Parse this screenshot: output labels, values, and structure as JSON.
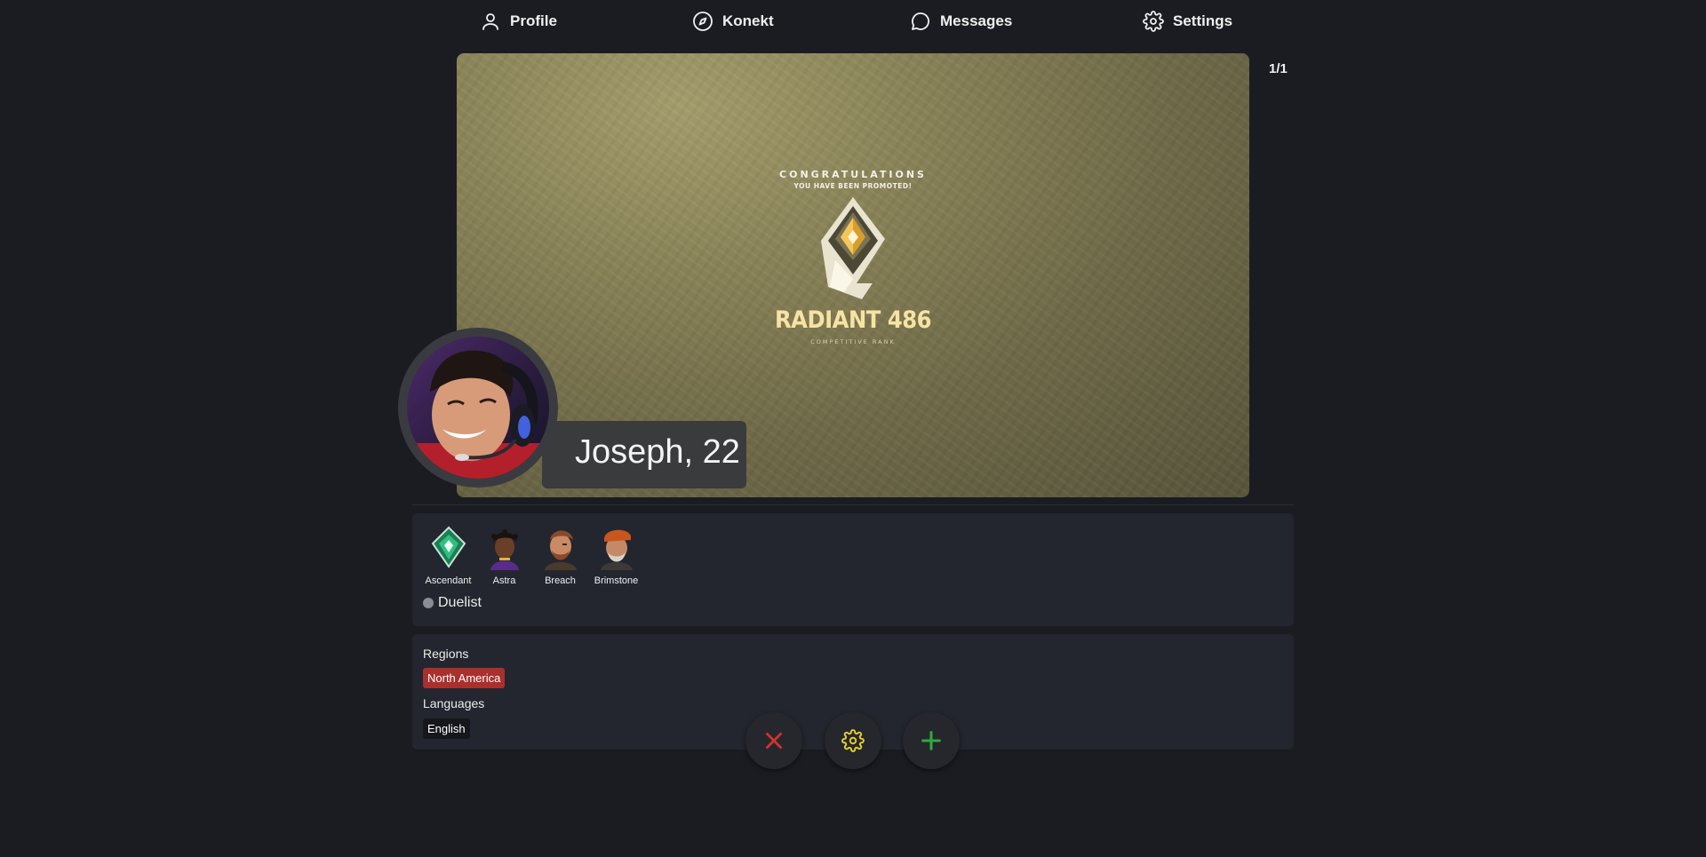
{
  "nav": {
    "items": [
      {
        "label": "Profile",
        "icon": "user-icon"
      },
      {
        "label": "Konekt",
        "icon": "compass-icon"
      },
      {
        "label": "Messages",
        "icon": "chat-bubble-icon"
      },
      {
        "label": "Settings",
        "icon": "gear-icon"
      }
    ]
  },
  "photo": {
    "counter": "1/1",
    "congrats": "CONGRATULATIONS",
    "promoted": "YOU HAVE BEEN PROMOTED!",
    "rank_name": "RADIANT 486",
    "rank_sub": "COMPETITIVE RANK"
  },
  "profile": {
    "name_age": "Joseph, 22"
  },
  "games": {
    "badges": [
      {
        "label": "Ascendant",
        "icon": "ascendant-rank-icon"
      },
      {
        "label": "Astra",
        "icon": "agent-astra-portrait"
      },
      {
        "label": "Breach",
        "icon": "agent-breach-portrait"
      },
      {
        "label": "Brimstone",
        "icon": "agent-brimstone-portrait"
      }
    ],
    "role": "Duelist"
  },
  "info": {
    "regions_label": "Regions",
    "region": "North America",
    "languages_label": "Languages",
    "language": "English"
  },
  "actions": {
    "reject_color": "#d0322f",
    "settings_color": "#e3cf2b",
    "accept_color": "#2faa3c"
  },
  "colors": {
    "background": "#1b1c21",
    "card": "#23262e",
    "region_tag": "#a8302d"
  }
}
